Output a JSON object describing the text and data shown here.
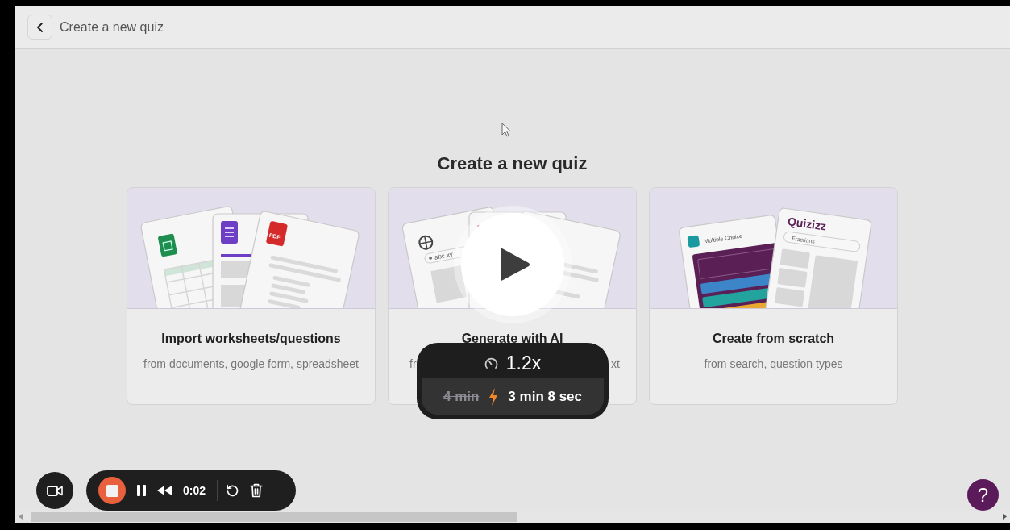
{
  "header": {
    "title": "Create a new quiz"
  },
  "heading": "Create a new quiz",
  "cards": [
    {
      "kind": "import",
      "title": "Import worksheets/questions",
      "subtitle": "from documents, google form, spreadsheet",
      "illustration_labels": [
        "PDF"
      ]
    },
    {
      "kind": "ai",
      "title": "Generate with AI",
      "subtitle_parts": [
        "fr",
        "xt"
      ],
      "illustration_labels": [
        "abc.xy"
      ]
    },
    {
      "kind": "scratch",
      "title": "Create from scratch",
      "subtitle": "from search, question types",
      "illustration_labels": [
        "Multiple Choice",
        "Quizizz",
        "Fractions"
      ]
    }
  ],
  "player": {
    "speed": "1.2x",
    "original_duration": "4 min",
    "new_duration": "3 min 8 sec"
  },
  "recorder": {
    "elapsed": "0:02"
  },
  "help": {
    "label": "?"
  }
}
